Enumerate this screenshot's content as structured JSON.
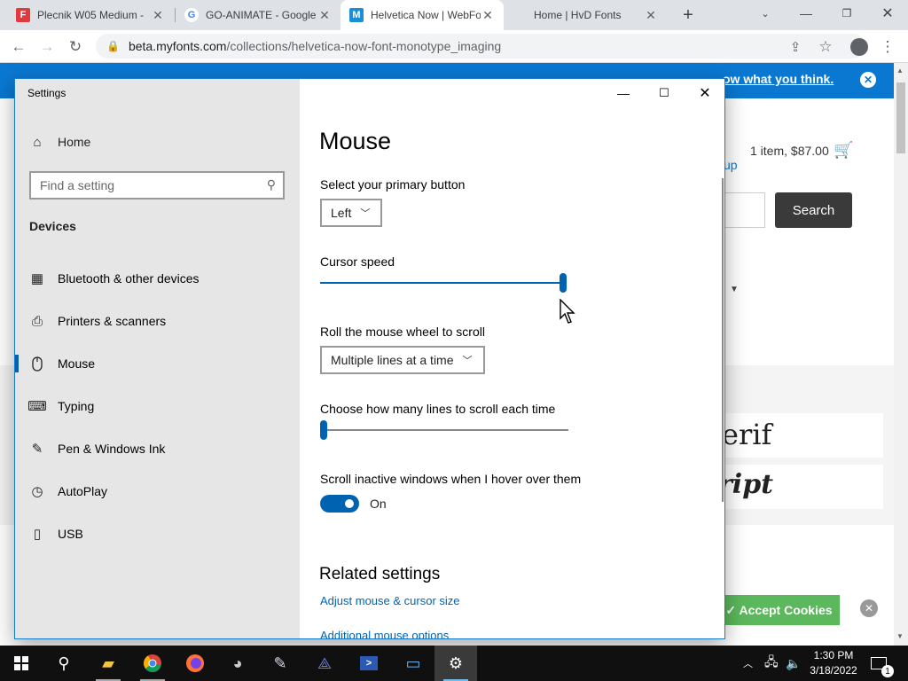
{
  "browser": {
    "tabs": [
      {
        "title": "Plecnik W05 Medium -",
        "icon": "fonts-f-icon",
        "color": "#e03a3e"
      },
      {
        "title": "GO-ANIMATE - Google",
        "icon": "google-icon",
        "color": "#4285f4"
      },
      {
        "title": "Helvetica Now | WebFo",
        "icon": "myfonts-icon",
        "color": "#1a8fd6"
      },
      {
        "title": "Home | HvD Fonts",
        "icon": "hvd-icon",
        "color": "#dddddd"
      }
    ],
    "url_host": "beta.myfonts.com",
    "url_path": "/collections/helvetica-now-font-monotype_imaging"
  },
  "webpage": {
    "banner_link": "ow what you think.",
    "cart": "1 item, $87.00",
    "signup": "up",
    "search_button": "Search",
    "font_card_1": "erif",
    "font_card_2": "ript",
    "accept_cookies": "✓ Accept Cookies",
    "accent": "#0a78d1"
  },
  "settings": {
    "window_title": "Settings",
    "home": "Home",
    "search_placeholder": "Find a setting",
    "group": "Devices",
    "nav": [
      {
        "label": "Bluetooth & other devices",
        "icon": "bluetooth-devices-icon"
      },
      {
        "label": "Printers & scanners",
        "icon": "printer-icon"
      },
      {
        "label": "Mouse",
        "icon": "mouse-icon",
        "selected": true
      },
      {
        "label": "Typing",
        "icon": "keyboard-icon"
      },
      {
        "label": "Pen & Windows Ink",
        "icon": "pen-icon"
      },
      {
        "label": "AutoPlay",
        "icon": "autoplay-icon"
      },
      {
        "label": "USB",
        "icon": "usb-icon"
      }
    ],
    "heading": "Mouse",
    "primary_button_label": "Select your primary button",
    "primary_button_value": "Left",
    "cursor_speed_label": "Cursor speed",
    "cursor_speed_fraction": 1.0,
    "wheel_label": "Roll the mouse wheel to scroll",
    "wheel_value": "Multiple lines at a time",
    "lines_label": "Choose how many lines to scroll each time",
    "lines_fraction": 0.0,
    "inactive_label": "Scroll inactive windows when I hover over them",
    "inactive_state": "On",
    "related_heading": "Related settings",
    "related_links": [
      "Adjust mouse & cursor size",
      "Additional mouse options"
    ],
    "accent": "#0063b1"
  },
  "taskbar": {
    "apps": [
      "start-icon",
      "search-icon",
      "file-explorer-icon",
      "chrome-icon",
      "firefox-icon",
      "raccoon-app-icon",
      "paint-app-icon",
      "vector-app-icon",
      "powershell-icon",
      "remote-desktop-icon",
      "settings-gear-icon"
    ],
    "time": "1:30 PM",
    "date": "3/18/2022",
    "notification_count": "1"
  }
}
